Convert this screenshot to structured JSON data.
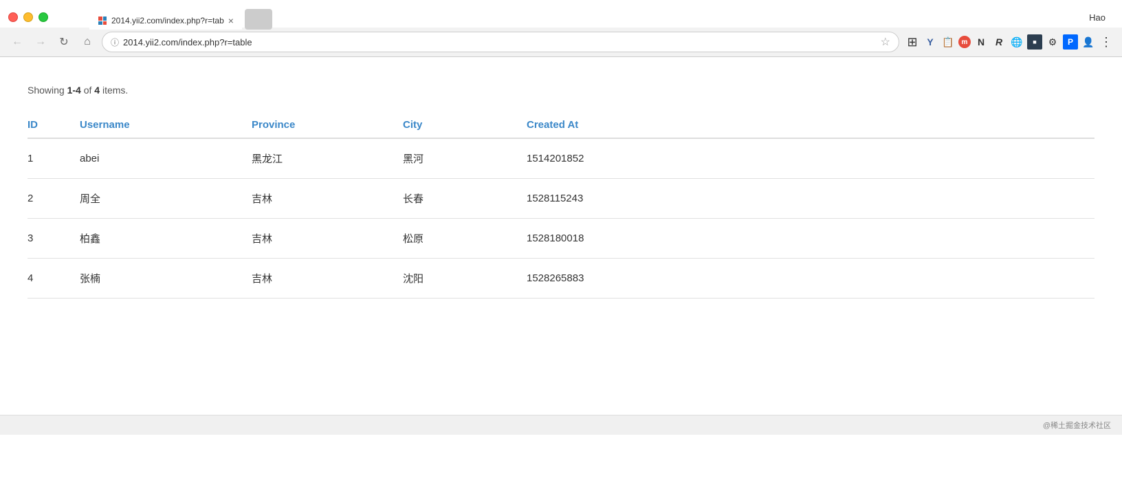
{
  "browser": {
    "url": "2014.yii2.com/index.php?r=table",
    "url_display": "2014.yii2.com/index.php?r=tab",
    "tab_title": "2014.yii2.com/index.php?r=tab",
    "user_label": "Hao"
  },
  "page": {
    "showing_text_prefix": "Showing ",
    "showing_range": "1-4",
    "showing_of": " of ",
    "showing_count": "4",
    "showing_suffix": " items."
  },
  "table": {
    "columns": [
      "ID",
      "Username",
      "Province",
      "City",
      "Created At"
    ],
    "rows": [
      {
        "id": "1",
        "username": "abei",
        "province": "黑龙江",
        "city": "黑河",
        "created_at": "1514201852"
      },
      {
        "id": "2",
        "username": "周全",
        "province": "吉林",
        "city": "长春",
        "created_at": "1528115243"
      },
      {
        "id": "3",
        "username": "柏鑫",
        "province": "吉林",
        "city": "松原",
        "created_at": "1528180018"
      },
      {
        "id": "4",
        "username": "张楠",
        "province": "吉林",
        "city": "沈阳",
        "created_at": "1528265883"
      }
    ]
  },
  "footer": {
    "credit": "@稀土掘金技术社区"
  },
  "icons": {
    "back": "←",
    "forward": "→",
    "refresh": "↻",
    "home": "⌂",
    "secure": "ⓘ",
    "star": "☆",
    "more": "⋮",
    "tab_close": "×"
  }
}
